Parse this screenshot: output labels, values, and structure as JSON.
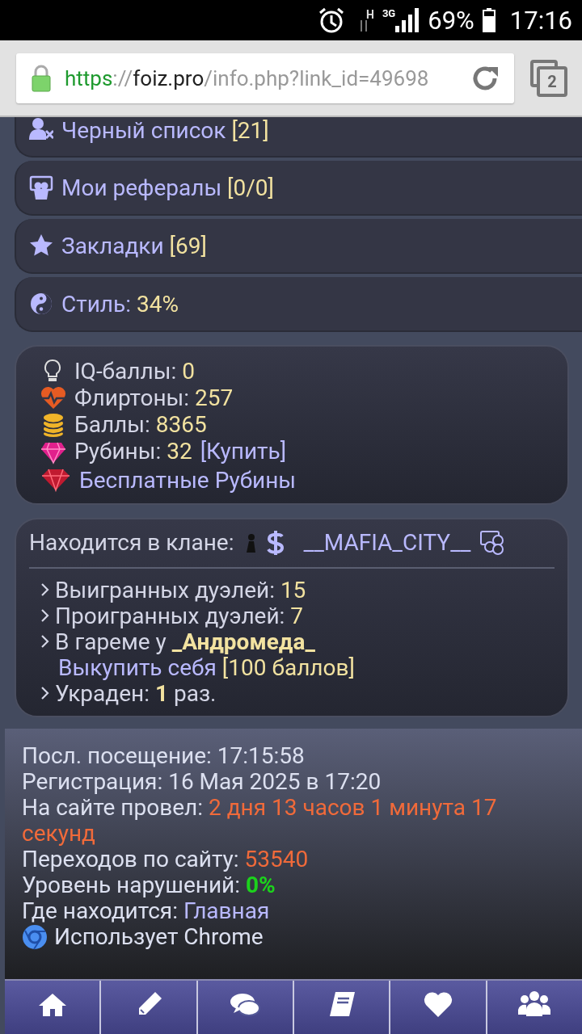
{
  "status_bar": {
    "network_type": "H",
    "signal_label": "3G",
    "battery": "69%",
    "time": "17:16"
  },
  "address_bar": {
    "scheme": "https",
    "separator": "://",
    "host": "foiz.pro",
    "path": "/info.php?link_id=49698",
    "tab_count": "2"
  },
  "menu_items": [
    {
      "label": "Черный список",
      "count": "[21]"
    },
    {
      "label": "Мои рефералы",
      "count": "[0/0]"
    },
    {
      "label": "Закладки",
      "count": "[69]"
    },
    {
      "label": "Стиль:",
      "count": "34%"
    }
  ],
  "balances": [
    {
      "label": "IQ-баллы:",
      "value": "0"
    },
    {
      "label": "Флиртоны:",
      "value": "257"
    },
    {
      "label": "Баллы:",
      "value": "8365"
    },
    {
      "label": "Рубины:",
      "value": "32",
      "link": "[Купить]"
    }
  ],
  "free_rubies_link": "Бесплатные Рубины",
  "clan": {
    "label": "Находится в клане:",
    "name": "__MAFIA_CITY__"
  },
  "duel_stats": [
    {
      "kind": "stat",
      "label": "Выигранных дуэлей:",
      "value": "15"
    },
    {
      "kind": "stat",
      "label": "Проигранных дуэлей:",
      "value": "7"
    },
    {
      "kind": "harem",
      "label": "В гареме у",
      "value": "_Андромеда_",
      "action": "Выкупить себя",
      "price": "[100 баллов]"
    },
    {
      "kind": "stolen",
      "label": "Украден:",
      "value": "1",
      "suffix": "раз."
    }
  ],
  "profile_info": [
    {
      "kind": "line",
      "label": "Посл. посещение:",
      "value": "17:15:58",
      "color": "#dce0f0",
      "bold": false
    },
    {
      "kind": "line",
      "label": "Регистрация:",
      "value": "16 Мая 2025 в 17:20",
      "color": "#dce0f0",
      "bold": false
    },
    {
      "kind": "line",
      "label": "На сайте провел:",
      "value": "2 дня 13 часов 1 минута 17 секунд",
      "color": "#f06a3a",
      "bold": false
    },
    {
      "kind": "line",
      "label": "Переходов по сайту:",
      "value": "53540",
      "color": "#f06a3a",
      "bold": false
    },
    {
      "kind": "line",
      "label": "Уровень нарушений:",
      "value": "0%",
      "color": "#1cd21c",
      "bold": true
    },
    {
      "kind": "line",
      "label": "Где находится:",
      "value": "Главная",
      "color": "#b9b9ff",
      "bold": false
    },
    {
      "kind": "browser",
      "label": "Использует Chrome"
    }
  ],
  "bottom_nav": [
    {
      "kind": "home"
    },
    {
      "kind": "write"
    },
    {
      "kind": "chat"
    },
    {
      "kind": "book"
    },
    {
      "kind": "heart"
    },
    {
      "kind": "users"
    }
  ]
}
